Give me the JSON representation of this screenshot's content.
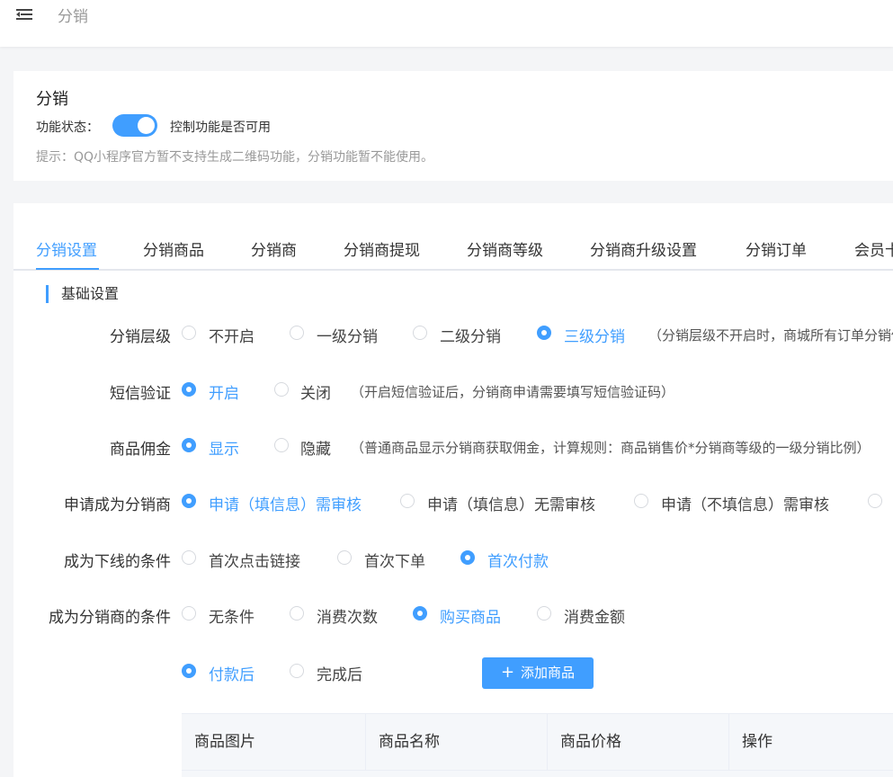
{
  "header": {
    "breadcrumb": "分销"
  },
  "status_card": {
    "title": "分销",
    "state_label": "功能状态：",
    "state_desc": "控制功能是否可用",
    "toggle_on": true,
    "tip": "提示：QQ小程序官方暂不支持生成二维码功能，分销功能暂不能使用。"
  },
  "tabs": [
    "分销设置",
    "分销商品",
    "分销商",
    "分销商提现",
    "分销商等级",
    "分销商升级设置",
    "分销订单",
    "会员卡"
  ],
  "active_tab": 0,
  "section_title": "基础设置",
  "rows": {
    "level": {
      "label": "分销层级",
      "options": [
        "不开启",
        "一级分销",
        "二级分销",
        "三级分销"
      ],
      "selected": 3,
      "hint": "（分销层级不开启时，商城所有订单分销佣金为0）"
    },
    "sms": {
      "label": "短信验证",
      "options": [
        "开启",
        "关闭"
      ],
      "selected": 0,
      "hint": "（开启短信验证后，分销商申请需要填写短信验证码）"
    },
    "commission": {
      "label": "商品佣金",
      "options": [
        "显示",
        "隐藏"
      ],
      "selected": 0,
      "hint": "（普通商品显示分销商获取佣金，计算规则：商品销售价*分销商等级的一级分销比例）"
    },
    "apply": {
      "label": "申请成为分销商",
      "options": [
        "申请（填信息）需审核",
        "申请（填信息）无需审核",
        "申请（不填信息）需审核"
      ],
      "selected": 0
    },
    "downline": {
      "label": "成为下线的条件",
      "options": [
        "首次点击链接",
        "首次下单",
        "首次付款"
      ],
      "selected": 2
    },
    "become": {
      "label": "成为分销商的条件",
      "options": [
        "无条件",
        "消费次数",
        "购买商品",
        "消费金额"
      ],
      "selected": 2
    },
    "timing": {
      "options": [
        "付款后",
        "完成后"
      ],
      "selected": 0
    }
  },
  "add_button": {
    "icon": "plus-icon",
    "label": "添加商品"
  },
  "table": {
    "columns": [
      "商品图片",
      "商品名称",
      "商品价格",
      "操作"
    ]
  },
  "colors": {
    "accent": "#409eff",
    "muted": "#999999"
  }
}
